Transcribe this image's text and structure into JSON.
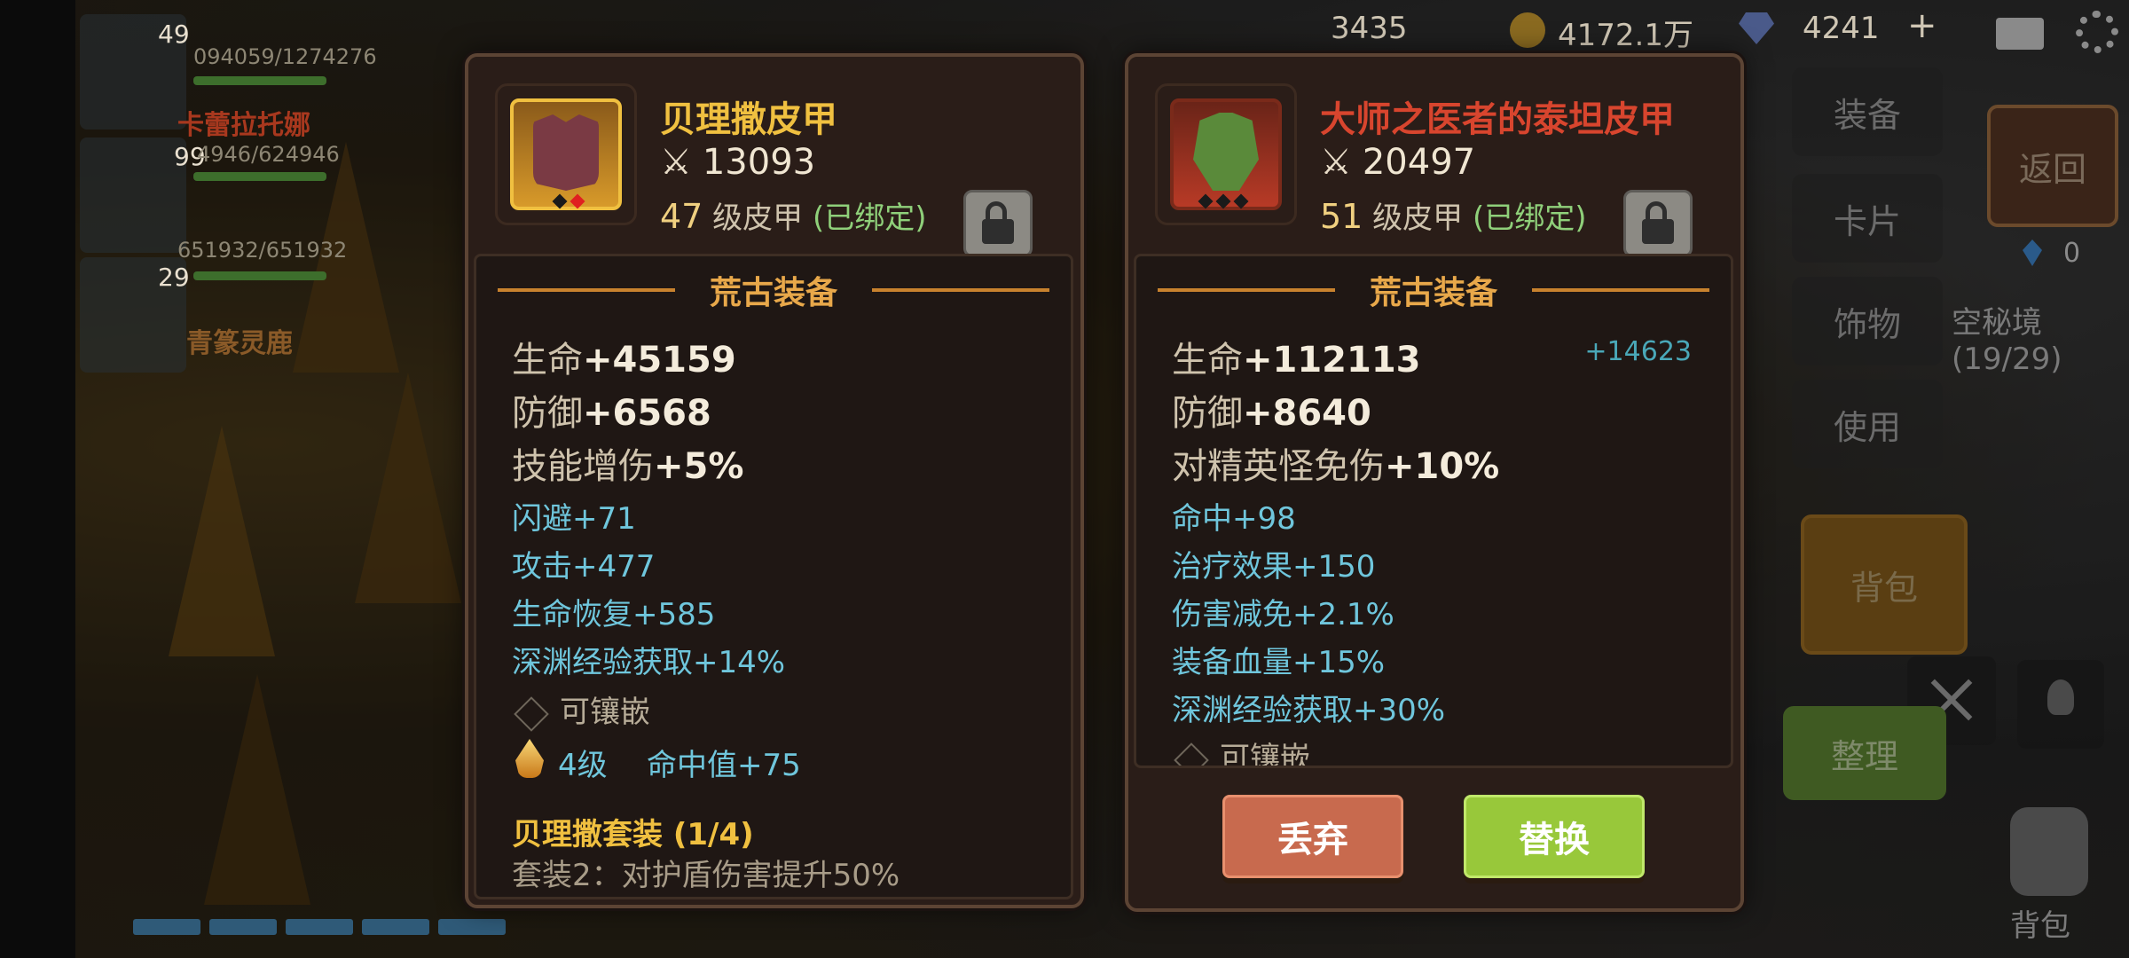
{
  "top_bar": {
    "currency1": "3435",
    "gold": "4172.1万",
    "gems": "4241",
    "plus": "+"
  },
  "left_hud": {
    "members": [
      {
        "level": "49",
        "hp": "094059/1274276",
        "name": "卡蕾拉托娜"
      },
      {
        "level": "99",
        "hp": "4946/624946"
      },
      {
        "level": "29",
        "hp": "651932/651932",
        "name": "青篆灵鹿"
      }
    ]
  },
  "right_menu": {
    "equip": "装备",
    "back": "返回",
    "card": "卡片",
    "accessory": "饰物",
    "use": "使用",
    "bag": "背包",
    "sort": "整理",
    "bag_bottom": "背包",
    "secret": "空秘境 (19/29)",
    "crystals": "0"
  },
  "left_item": {
    "name": "贝理撒皮甲",
    "name_color": "#f0c040",
    "power": "13093",
    "level": "47",
    "type_text": "级皮甲",
    "bound": "(已绑定)",
    "section_title": "荒古装备",
    "main_stats": [
      {
        "label": "生命",
        "value": "+45159"
      },
      {
        "label": "防御",
        "value": "+6568"
      },
      {
        "label": "技能增伤",
        "value": "+5%"
      }
    ],
    "sub_stats": [
      "闪避+71",
      "攻击+477",
      "生命恢复+585",
      "深渊经验获取+14%"
    ],
    "socket": "可镶嵌",
    "gem_level": "4级",
    "gem_effect": "命中值+75",
    "set_name": "贝理撒套装 (1/4)",
    "set_bonus": "套装2：对护盾伤害提升50%"
  },
  "right_item": {
    "name": "大师之医者的泰坦皮甲",
    "name_color": "#d8452e",
    "power": "20497",
    "level": "51",
    "type_text": "级皮甲",
    "bound": "(已绑定)",
    "section_title": "荒古装备",
    "diff": "+14623",
    "main_stats": [
      {
        "label": "生命",
        "value": "+112113"
      },
      {
        "label": "防御",
        "value": "+8640"
      },
      {
        "label": "对精英怪免伤",
        "value": "+10%"
      }
    ],
    "sub_stats": [
      "命中+98",
      "治疗效果+150",
      "伤害减免+2.1%",
      "装备血量+15%",
      "深渊经验获取+30%"
    ],
    "socket": "可镶嵌",
    "discard_label": "丢弃",
    "replace_label": "替换"
  }
}
